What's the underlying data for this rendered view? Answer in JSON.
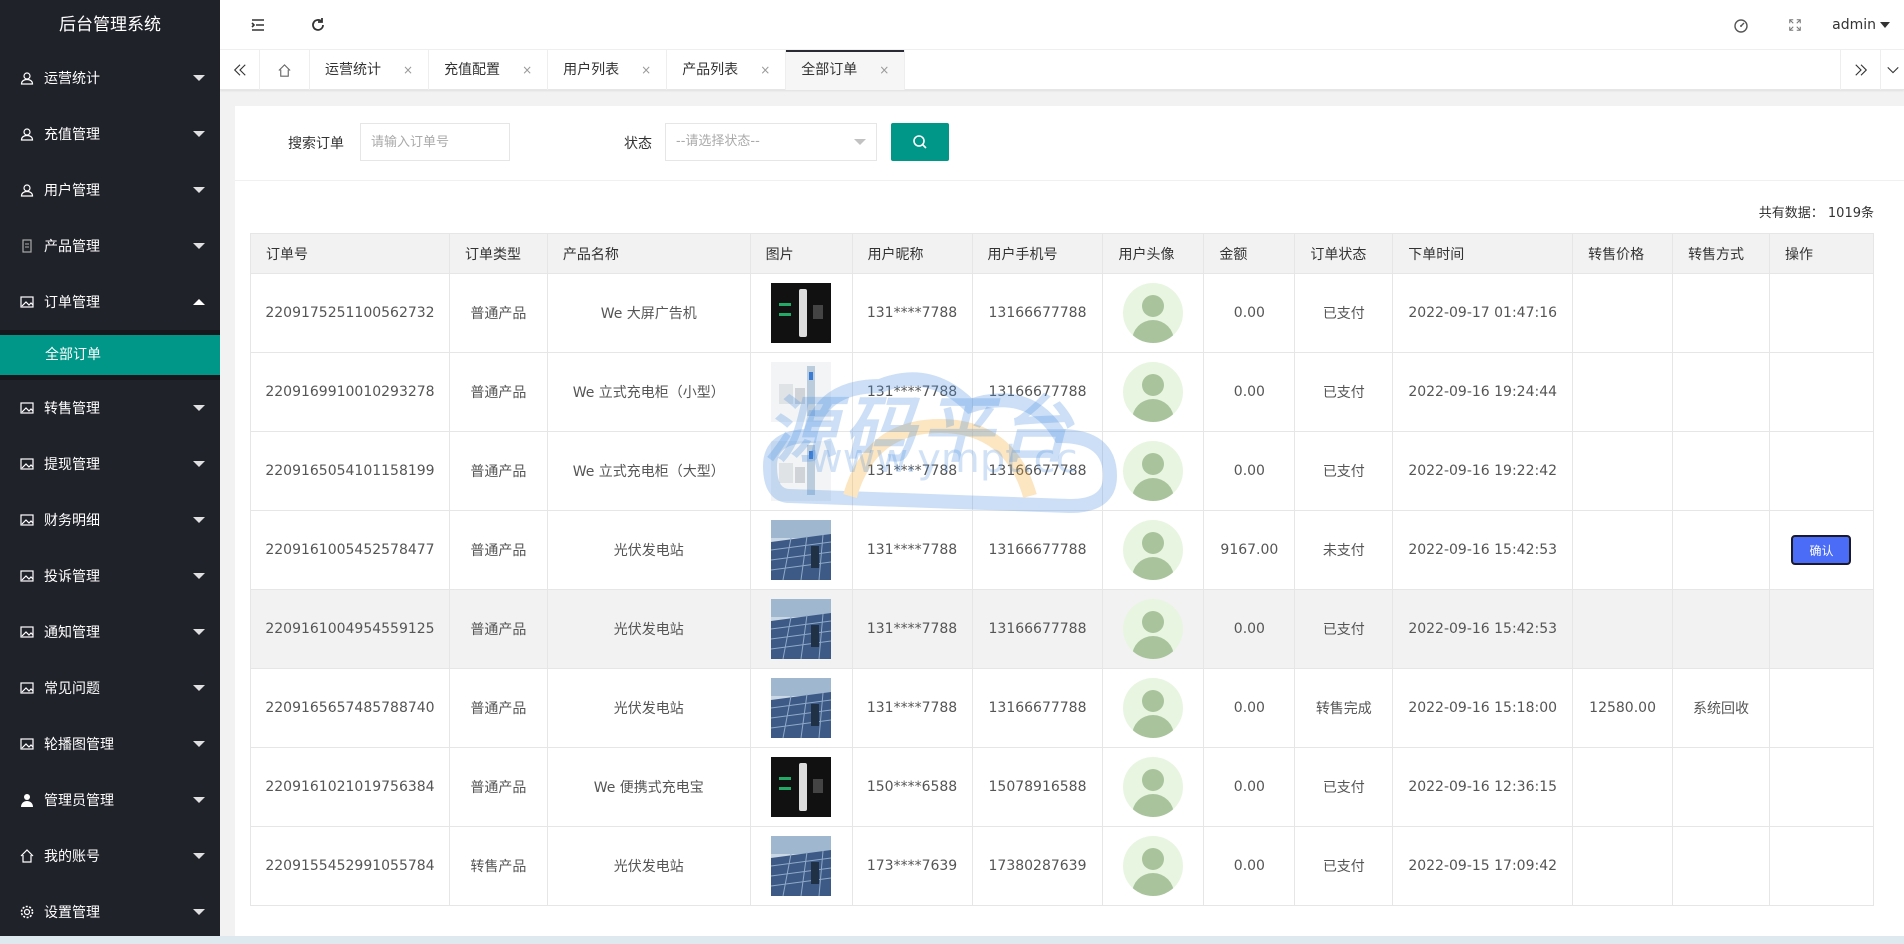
{
  "app_title": "后台管理系统",
  "sidebar": {
    "items": [
      {
        "label": "运营统计",
        "icon": "user-icon"
      },
      {
        "label": "充值管理",
        "icon": "user-icon"
      },
      {
        "label": "用户管理",
        "icon": "user-icon"
      },
      {
        "label": "产品管理",
        "icon": "file-icon"
      },
      {
        "label": "订单管理",
        "icon": "image-icon",
        "open": true
      },
      {
        "label": "转售管理",
        "icon": "image-icon"
      },
      {
        "label": "提现管理",
        "icon": "image-icon"
      },
      {
        "label": "财务明细",
        "icon": "image-icon"
      },
      {
        "label": "投诉管理",
        "icon": "image-icon"
      },
      {
        "label": "通知管理",
        "icon": "image-icon"
      },
      {
        "label": "常见问题",
        "icon": "image-icon"
      },
      {
        "label": "轮播图管理",
        "icon": "image-icon"
      },
      {
        "label": "管理员管理",
        "icon": "person-icon"
      },
      {
        "label": "我的账号",
        "icon": "home-icon"
      },
      {
        "label": "设置管理",
        "icon": "gear-icon"
      }
    ],
    "active_sub": "全部订单"
  },
  "header": {
    "user": "admin"
  },
  "tabs": [
    {
      "label": "运营统计",
      "close": "×"
    },
    {
      "label": "充值配置",
      "close": "×"
    },
    {
      "label": "用户列表",
      "close": "×"
    },
    {
      "label": "产品列表",
      "close": "×"
    },
    {
      "label": "全部订单",
      "close": "×",
      "active": true
    }
  ],
  "search": {
    "order_label": "搜索订单",
    "order_placeholder": "请输入订单号",
    "status_label": "状态",
    "status_placeholder": "--请选择状态--"
  },
  "total_text": "共有数据： 1019条",
  "table": {
    "headers": [
      "订单号",
      "订单类型",
      "产品名称",
      "图片",
      "用户昵称",
      "用户手机号",
      "用户头像",
      "金额",
      "订单状态",
      "下单时间",
      "转售价格",
      "转售方式",
      "操作"
    ],
    "rows": [
      {
        "order_no": "2209175251100562732",
        "type": "普通产品",
        "product": "We 大屏广告机",
        "img": "dark",
        "nick": "131****7788",
        "phone": "13166677788",
        "amount": "0.00",
        "status": "已支付",
        "time": "2022-09-17 01:47:16",
        "resale_price": "",
        "resale_way": "",
        "action": ""
      },
      {
        "order_no": "2209169910010293278",
        "type": "普通产品",
        "product": "We 立式充电柜（小型）",
        "img": "light",
        "nick": "131****7788",
        "phone": "13166677788",
        "amount": "0.00",
        "status": "已支付",
        "time": "2022-09-16 19:24:44",
        "resale_price": "",
        "resale_way": "",
        "action": ""
      },
      {
        "order_no": "2209165054101158199",
        "type": "普通产品",
        "product": "We 立式充电柜（大型）",
        "img": "light",
        "nick": "131****7788",
        "phone": "13166677788",
        "amount": "0.00",
        "status": "已支付",
        "time": "2022-09-16 19:22:42",
        "resale_price": "",
        "resale_way": "",
        "action": ""
      },
      {
        "order_no": "2209161005452578477",
        "type": "普通产品",
        "product": "光伏发电站",
        "img": "solar",
        "nick": "131****7788",
        "phone": "13166677788",
        "amount": "9167.00",
        "status": "未支付",
        "time": "2022-09-16 15:42:53",
        "resale_price": "",
        "resale_way": "",
        "action": "确认"
      },
      {
        "order_no": "2209161004954559125",
        "type": "普通产品",
        "product": "光伏发电站",
        "img": "solar",
        "nick": "131****7788",
        "phone": "13166677788",
        "amount": "0.00",
        "status": "已支付",
        "time": "2022-09-16 15:42:53",
        "resale_price": "",
        "resale_way": "",
        "action": "",
        "highlight": true
      },
      {
        "order_no": "2209165657485788740",
        "type": "普通产品",
        "product": "光伏发电站",
        "img": "solar",
        "nick": "131****7788",
        "phone": "13166677788",
        "amount": "0.00",
        "status": "转售完成",
        "time": "2022-09-16 15:18:00",
        "resale_price": "12580.00",
        "resale_way": "系统回收",
        "action": ""
      },
      {
        "order_no": "2209161021019756384",
        "type": "普通产品",
        "product": "We 便携式充电宝",
        "img": "dark",
        "nick": "150****6588",
        "phone": "15078916588",
        "amount": "0.00",
        "status": "已支付",
        "time": "2022-09-16 12:36:15",
        "resale_price": "",
        "resale_way": "",
        "action": ""
      },
      {
        "order_no": "2209155452991055784",
        "type": "转售产品",
        "product": "光伏发电站",
        "img": "solar",
        "nick": "173****7639",
        "phone": "17380287639",
        "amount": "0.00",
        "status": "已支付",
        "time": "2022-09-15 17:09:42",
        "resale_price": "",
        "resale_way": "",
        "action": ""
      }
    ]
  },
  "watermark": {
    "title": "源码平台",
    "url": "www.ympt.cc"
  },
  "colors": {
    "sidebar_bg": "#20222a",
    "accent": "#009688",
    "confirm_btn": "#4a6cf7"
  }
}
